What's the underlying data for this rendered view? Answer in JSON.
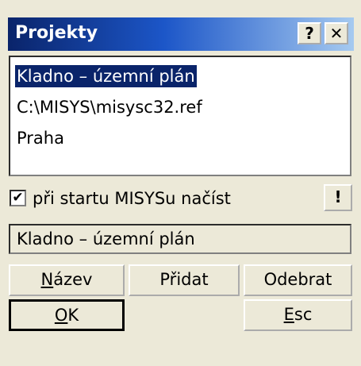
{
  "window": {
    "title": "Projekty",
    "help_label": "?",
    "close_label": "✕"
  },
  "projects": {
    "items": [
      {
        "label": "Kladno – územní plán",
        "selected": true
      },
      {
        "label": "C:\\MISYS\\misysc32.ref",
        "selected": false
      },
      {
        "label": "Praha",
        "selected": false
      }
    ]
  },
  "startup": {
    "checked": true,
    "check_mark": "✔",
    "label": "při startu MISYSu načíst",
    "action_label": "!"
  },
  "name_field": {
    "value": "Kladno – územní plán"
  },
  "buttons": {
    "nazev": {
      "mnemonic": "N",
      "rest": "ázev"
    },
    "pridat": "Přidat",
    "odebrat": "Odebrat",
    "ok": {
      "mnemonic": "O",
      "rest": "K"
    },
    "esc": {
      "mnemonic": "E",
      "rest": "sc"
    }
  }
}
